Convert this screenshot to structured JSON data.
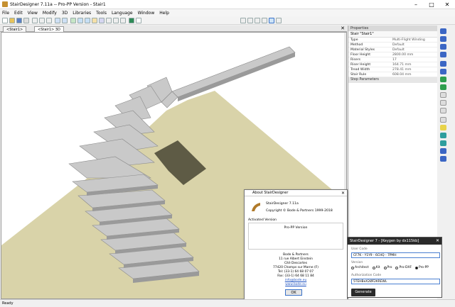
{
  "window": {
    "title": "StairDesigner 7.11a -- Pro-PP Version - Stair1"
  },
  "menu": [
    "File",
    "Edit",
    "View",
    "Modify",
    "3D",
    "Libraries",
    "Tools",
    "Language",
    "Window",
    "Help"
  ],
  "tabs": [
    "<Stair1>",
    "<Stair1> 3D"
  ],
  "properties": {
    "header": "Properties",
    "selector": "Stair \"Stair1\"",
    "rows": [
      {
        "k": "Type",
        "v": "Multi-Flight Winding"
      },
      {
        "k": "Method",
        "v": "Default"
      },
      {
        "k": "Material Styles",
        "v": "Default"
      },
      {
        "k": "Floor Height",
        "v": "2800.00 mm"
      },
      {
        "k": "Risers",
        "v": "17"
      },
      {
        "k": "Riser Height",
        "v": "164.71 mm"
      },
      {
        "k": "Tread Width",
        "v": "278.41 mm"
      },
      {
        "k": "Stair Rule",
        "v": "608.04 mm"
      }
    ],
    "section": "Step Parameters"
  },
  "about": {
    "title": "About StairDesigner",
    "version": "StairDesigner 7.11a",
    "copyright": "Copyright © Bode & Partners 1999-2018",
    "activated_label": "Activated Version",
    "activated_value": "Pro-PP Version",
    "address": [
      "Bode & Partners",
      "11 rue Albert Einstein",
      "Cité Descartes",
      "77420 Champs sur Marne (F)",
      "Tel: (33-1) 64 68 07 07",
      "Fax: (33-1) 64 68 11 84"
    ],
    "email": "info@bode.eu",
    "web": "www.bode.eu",
    "ok": "OK"
  },
  "keygen": {
    "title": "StairDesigner 7 - [Keygen by dx115kb]",
    "user_code_label": "User Code",
    "user_code": "CF7K - Y1Y9 - 6CHQ - 7PMH",
    "version_label": "Version",
    "versions": [
      "Architect",
      "Kit",
      "Pro",
      "Pro-DXF",
      "Pro-PP"
    ],
    "selected": "Pro-PP",
    "auth_label": "Authorization Code",
    "auth_code": "5TEHBeX2ØF2KREWL",
    "generate": "Generate"
  },
  "status": "Ready",
  "colors": {
    "floor": "#d9d3a9",
    "step": "#c9c9c9",
    "shadow": "#5e5b45"
  }
}
